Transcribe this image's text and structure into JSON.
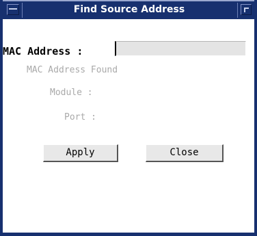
{
  "window": {
    "title": "Find Source Address",
    "colors": {
      "frame": "#17306f",
      "title_text": "#ffffff",
      "client_bg": "#ffffff",
      "input_bg": "#e4e4e4",
      "button_bg": "#e8e8e8",
      "disabled_text": "#a9a9a9"
    },
    "icons": {
      "system_menu": "window-menu-icon",
      "maximize": "maximize-icon"
    }
  },
  "form": {
    "mac_address_label": "MAC Address :",
    "mac_address_value": "",
    "mac_found_label": "MAC Address Found",
    "module_label": "Module :",
    "module_value": "",
    "port_label": "Port :",
    "port_value": ""
  },
  "buttons": {
    "apply": "Apply",
    "close": "Close"
  }
}
